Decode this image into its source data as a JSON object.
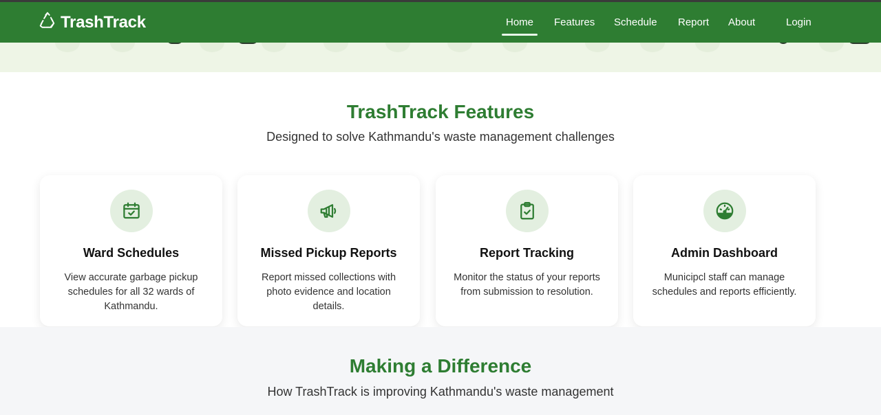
{
  "brand": {
    "name": "TrashTrack",
    "icon": "recycle-icon"
  },
  "nav": [
    {
      "label": "Home",
      "active": true
    },
    {
      "label": "Features"
    },
    {
      "label": "Schedule"
    },
    {
      "label": "Report"
    },
    {
      "label": "About"
    },
    {
      "label": "Login"
    }
  ],
  "features": {
    "title": "TrashTrack Features",
    "subtitle": "Designed to solve Kathmandu's waste management challenges",
    "cards": [
      {
        "icon": "calendar-check-icon",
        "title": "Ward Schedules",
        "description": "View accurate garbage pickup schedules for all 32 wards of Kathmandu."
      },
      {
        "icon": "megaphone-icon",
        "title": "Missed Pickup Reports",
        "description": "Report missed collections with photo evidence and location details."
      },
      {
        "icon": "clipboard-check-icon",
        "title": "Report Tracking",
        "description": "Monitor the status of your reports from submission to resolution."
      },
      {
        "icon": "gauge-icon",
        "title": "Admin Dashboard",
        "description": "Municipcl staff can manage schedules and reports efficiently."
      }
    ]
  },
  "difference": {
    "title": "Making a Difference",
    "subtitle": "How TrashTrack is improving Kathmandu's waste management"
  },
  "colors": {
    "primary": "#2e7d32",
    "icon_bg": "#e3efe0",
    "section_bg": "#f5f6f8"
  }
}
